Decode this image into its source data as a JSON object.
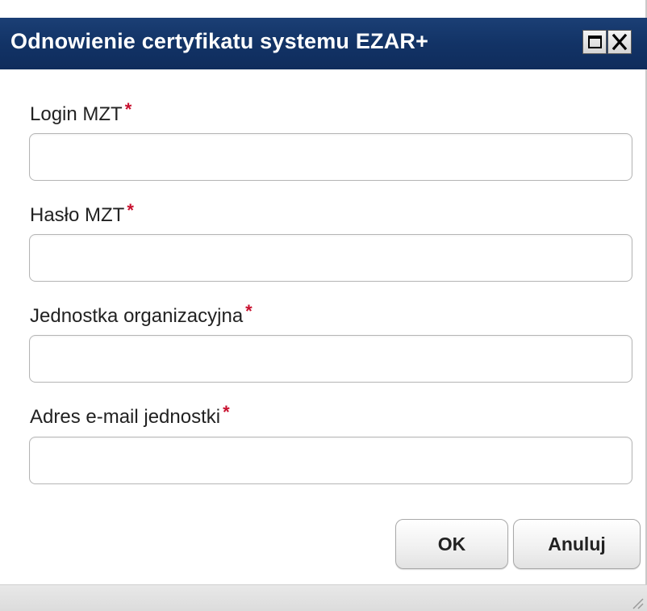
{
  "dialog": {
    "title": "Odnowienie certyfikatu systemu EZAR+",
    "maximize_icon": "maximize-icon",
    "close_icon": "close-icon"
  },
  "form": {
    "required_marker": "*",
    "fields": [
      {
        "label": "Login MZT",
        "value": "",
        "placeholder": ""
      },
      {
        "label": "Hasło MZT",
        "value": "",
        "placeholder": ""
      },
      {
        "label": "Jednostka organizacyjna",
        "value": "",
        "placeholder": ""
      },
      {
        "label": "Adres e-mail jednostki",
        "value": "",
        "placeholder": ""
      }
    ]
  },
  "buttons": {
    "ok_label": "OK",
    "cancel_label": "Anuluj"
  },
  "colors": {
    "titlebar": "#123366",
    "required": "#c8102e"
  }
}
